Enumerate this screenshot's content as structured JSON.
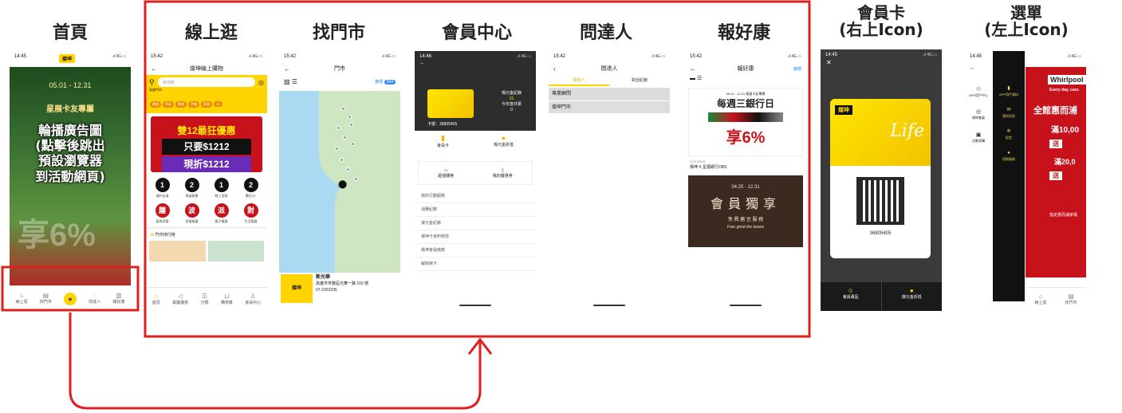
{
  "colors": {
    "frame_red": "#e01f1f",
    "brand_yellow": "#ffd400",
    "dark": "#2d2d2d"
  },
  "titles": {
    "home": "首頁",
    "online": "線上逛",
    "stores": "找門市",
    "member": "會員中心",
    "ask": "問達人",
    "health": "報好康",
    "card_line1": "會員卡",
    "card_line2": "(右上Icon)",
    "menu_line1": "選單",
    "menu_line2": "(左上Icon)"
  },
  "home": {
    "time": "14:45",
    "logo": "燦坤",
    "date": "05.01 - 12.31",
    "subtitle": "星展卡友專屬",
    "overlay": [
      "輪播廣告圖",
      "(點擊後跳出",
      "預設瀏覽器",
      "到活動網頁)"
    ],
    "tabs": [
      "線上逛",
      "找門市",
      "",
      "問達人",
      "報好康"
    ]
  },
  "online": {
    "time": "15:42",
    "title": "燦坤線上購物",
    "search_placeholder": "電視機",
    "location": "高雄門市",
    "promo_line1": "雙12最狂優惠",
    "promo_line2": "只要$1212",
    "promo_line3": "現折$1212",
    "icons_row1": [
      {
        "glyph": "1",
        "label": "福利出清",
        "color": "#111"
      },
      {
        "glyph": "2",
        "label": "瑪迷熱賣",
        "color": "#111"
      },
      {
        "glyph": "1",
        "label": "線上型錄",
        "color": "#111"
      },
      {
        "glyph": "2",
        "label": "數位3C",
        "color": "#111"
      }
    ],
    "icons_row2": [
      {
        "glyph": "膳",
        "label": "廚房家電",
        "color": "#c8121b"
      },
      {
        "glyph": "波",
        "label": "家電精選",
        "color": "#c8121b"
      },
      {
        "glyph": "派",
        "label": "親子優惠",
        "color": "#c8121b"
      },
      {
        "glyph": "對",
        "label": "生活電器",
        "color": "#c8121b"
      }
    ],
    "ranking": "門市排行榜",
    "tabs": [
      "首頁",
      "專屬優惠",
      "分類",
      "購物車",
      "會員中心"
    ]
  },
  "stores": {
    "time": "15:42",
    "title": "門市",
    "filter": "篩選",
    "count": "264",
    "store_name": "新光華",
    "store_addr": "高雄市苓雅區光華一路 160 號",
    "store_phone": "07-2262335"
  },
  "member": {
    "time": "14:46",
    "card_no": "卡號：36805405",
    "points_label": "燦元金紀錄",
    "points_value": "31",
    "year_label": "今年度共累",
    "year_value": "0",
    "shortcut1": "會員卡",
    "shortcut2": "燦元金折抵",
    "action1": "超值購券",
    "action2": "我的優惠券",
    "menu": [
      "我的行動服務",
      "消費紀錄",
      "燦元金紀錄",
      "燦坤卡資料修改",
      "燦坤會員條款",
      "解除綁卡"
    ]
  },
  "ask": {
    "time": "15:42",
    "title": "問達人",
    "tab1": "問達人",
    "tab2": "對話紀錄",
    "row1": "專業顧問",
    "row2": "燦坤門市"
  },
  "health": {
    "time": "15:42",
    "title": "報好康",
    "right": "篩選",
    "ad1_date": "05.01 - 12.31 星展卡友專屬",
    "ad1_title": "每週三銀行日",
    "ad1_big": "享6%",
    "post_date": "2021/05/01",
    "post_title": "燦坤 X 星展銀行DBS",
    "ad2_date": "04.25 - 12.31",
    "ad2_title": "會員獨享",
    "ad2_sub": "免 費 磨 豆 服 務",
    "ad2_script": "Free grind the beans"
  },
  "card": {
    "time": "14:45",
    "brand": "燦坤",
    "script": "Life",
    "number": "36805405",
    "btn1": "會員專區",
    "btn2": "燦元金折抵"
  },
  "menu": {
    "time": "14:45",
    "left_items": [
      "APP用戶中心",
      "燦坤會員",
      "活動導購"
    ],
    "dark_items": [
      "APP用戶資料",
      "我的訊息",
      "設定",
      "短期服務"
    ],
    "brand": "Whirlpool",
    "tagline": "Every day, care.",
    "sale": "全館惠而浦",
    "amount1": "滿10,00",
    "amount2": "滿20,0",
    "gift": "送",
    "footer": "指定惠而浦家電"
  }
}
